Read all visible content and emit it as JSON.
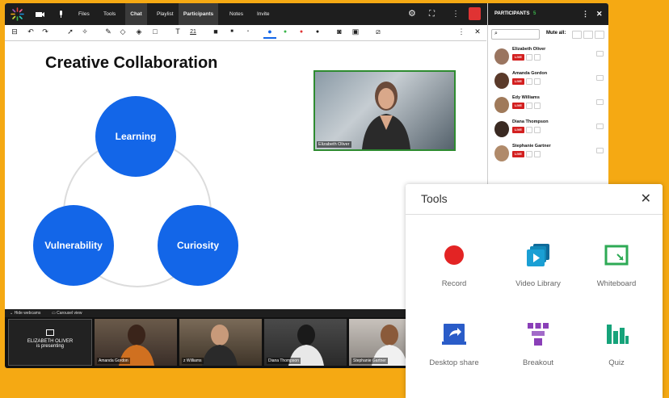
{
  "topbar": {
    "files": "Files",
    "tools": "Tools",
    "chat": "Chat",
    "playlist": "Playlist",
    "participants": "Participants",
    "notes": "Notes",
    "invite": "Invite"
  },
  "toolbar": {
    "font_size": "21"
  },
  "board": {
    "title": "Creative Collaboration",
    "circles": {
      "learning": "Learning",
      "vulnerability": "Vulnerability",
      "curiosity": "Curiosity"
    }
  },
  "video": {
    "label": "Elizabeth Oliver"
  },
  "strip": {
    "hide": "Hide webcams",
    "carousel": "Carousel view",
    "presenter_name": "ELIZABETH OLIVER",
    "presenter_status": "is presenting",
    "tiles": [
      "Amanda Gordon",
      "z Williams",
      "Diana Thompson",
      "Stephanie Gartner"
    ]
  },
  "panel": {
    "title": "PARTICIPANTS",
    "count": "5",
    "mute_all": "Mute all:",
    "participants": [
      {
        "name": "Elizabeth Oliver",
        "live": "LIVE"
      },
      {
        "name": "Amanda Gordon",
        "live": "LIVE"
      },
      {
        "name": "Edy Williams",
        "live": "LIVE"
      },
      {
        "name": "Diana Thompson",
        "live": "LIVE"
      },
      {
        "name": "Stephanie Gartner",
        "live": "LIVE"
      }
    ]
  },
  "tools": {
    "title": "Tools",
    "items": [
      "Record",
      "Video Library",
      "Whiteboard",
      "Desktop share",
      "Breakout",
      "Quiz"
    ]
  },
  "colors": {
    "accent": "#f5a913",
    "brand_blue": "#1366e8",
    "live_red": "#d32020"
  }
}
